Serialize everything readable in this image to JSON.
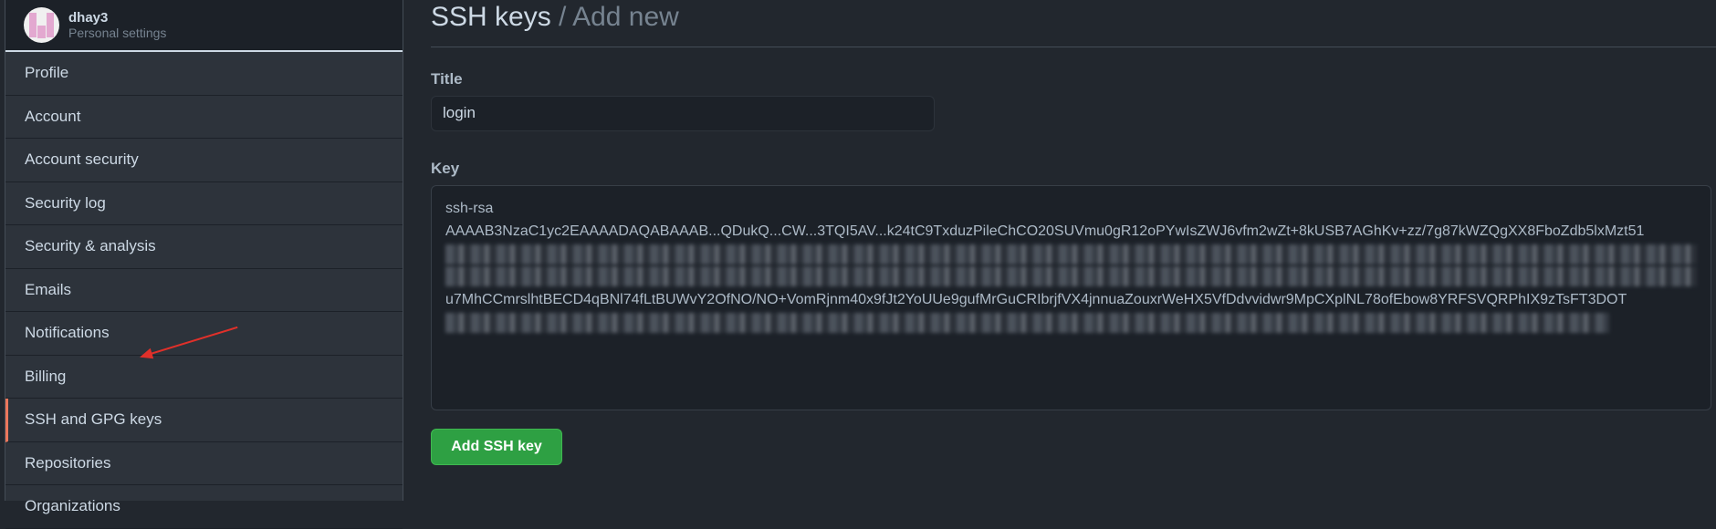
{
  "user": {
    "name": "dhay3",
    "subtitle": "Personal settings"
  },
  "sidebar": {
    "items": [
      {
        "label": "Profile"
      },
      {
        "label": "Account"
      },
      {
        "label": "Account security"
      },
      {
        "label": "Security log"
      },
      {
        "label": "Security & analysis"
      },
      {
        "label": "Emails"
      },
      {
        "label": "Notifications"
      },
      {
        "label": "Billing"
      },
      {
        "label": "SSH and GPG keys",
        "selected": true
      },
      {
        "label": "Repositories"
      },
      {
        "label": "Organizations"
      }
    ]
  },
  "header": {
    "title": "SSH keys",
    "separator": " / ",
    "subtitle": "Add new"
  },
  "form": {
    "title_label": "Title",
    "title_value": "login",
    "key_label": "Key",
    "key_lines": [
      "ssh-rsa",
      "AAAAB3NzaC1yc2EAAAADAQABAAAB...QDukQ...CW...3TQI5AV...k24tC9TxduzPileChCO20SUVmu0gR12oPYwIsZWJ6vfm2wZt+8kUSB7AGhKv+zz/7g87kWZQgXX8FboZdb5lxMzt51",
      "u7MhCCmrslhtBECD4qBNl74fLtBUWvY2OfNO/NO+VomRjnm40x9fJt2YoUUe9gufMrGuCRIbrjfVX4jnnuaZouxrWeHX5VfDdvvidwr9MpCXplNL78ofEbow8YRFSVQRPhIX9zTsFT3DOT"
    ],
    "submit_label": "Add SSH key"
  },
  "colors": {
    "accent_selected": "#ec775c",
    "button": "#2ea043",
    "annotation_arrow": "#e0302a"
  }
}
